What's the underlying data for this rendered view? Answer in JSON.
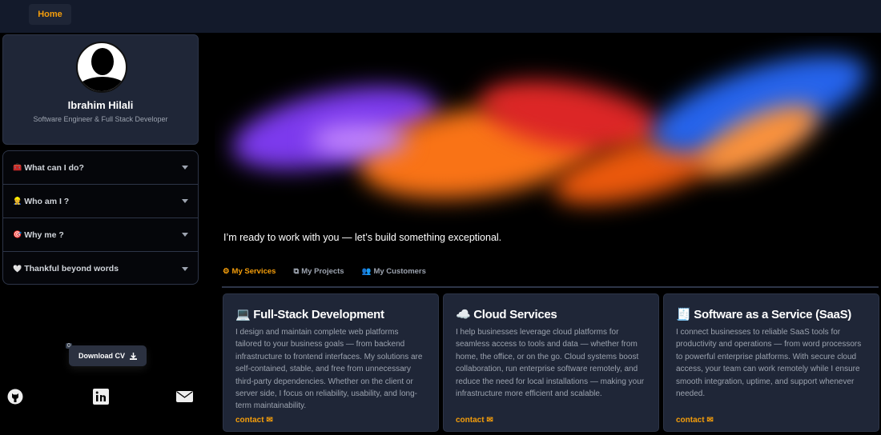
{
  "nav": {
    "home": "Home"
  },
  "profile": {
    "name": "Ibrahim Hilali",
    "role": "Software Engineer & Full Stack Developer"
  },
  "accordion": [
    {
      "icon": "🧰",
      "label": "What can I do?"
    },
    {
      "icon": "👷",
      "label": "Who am I ?"
    },
    {
      "icon": "🎯",
      "label": "Why me ?"
    },
    {
      "icon": "🤍",
      "label": "Thankful beyond words"
    }
  ],
  "download": {
    "label": "Download CV",
    "badge": "0"
  },
  "hero": {
    "caption": "I’m ready to work with you — let’s build something exceptional."
  },
  "tabs": [
    {
      "label": "My Services"
    },
    {
      "label": "My Projects"
    },
    {
      "label": "My Customers"
    }
  ],
  "cards": [
    {
      "icon": "💻",
      "title": "Full-Stack Development",
      "text": "I design and maintain complete web platforms tailored to your business goals — from backend infrastructure to frontend interfaces. My solutions are self-contained, stable, and free from unnecessary third-party dependencies. Whether on the client or server side, I focus on reliability, usability, and long-term maintainability.",
      "link": "contact"
    },
    {
      "icon": "☁️",
      "title": "Cloud Services",
      "text": "I help businesses leverage cloud platforms for seamless access to tools and data — whether from home, the office, or on the go. Cloud systems boost collaboration, run enterprise software remotely, and reduce the need for local installations — making your infrastructure more efficient and scalable.",
      "link": "contact"
    },
    {
      "icon": "🧾",
      "title": "Software as a Service (SaaS)",
      "text": "I connect businesses to reliable SaaS tools for productivity and operations — from word processors to powerful enterprise platforms. With secure cloud access, your team can work remotely while I ensure smooth integration, uptime, and support whenever needed.",
      "link": "contact"
    }
  ],
  "colors": {
    "accent": "#f59e0b",
    "card": "#1f2637",
    "topbar": "#131a2b"
  }
}
